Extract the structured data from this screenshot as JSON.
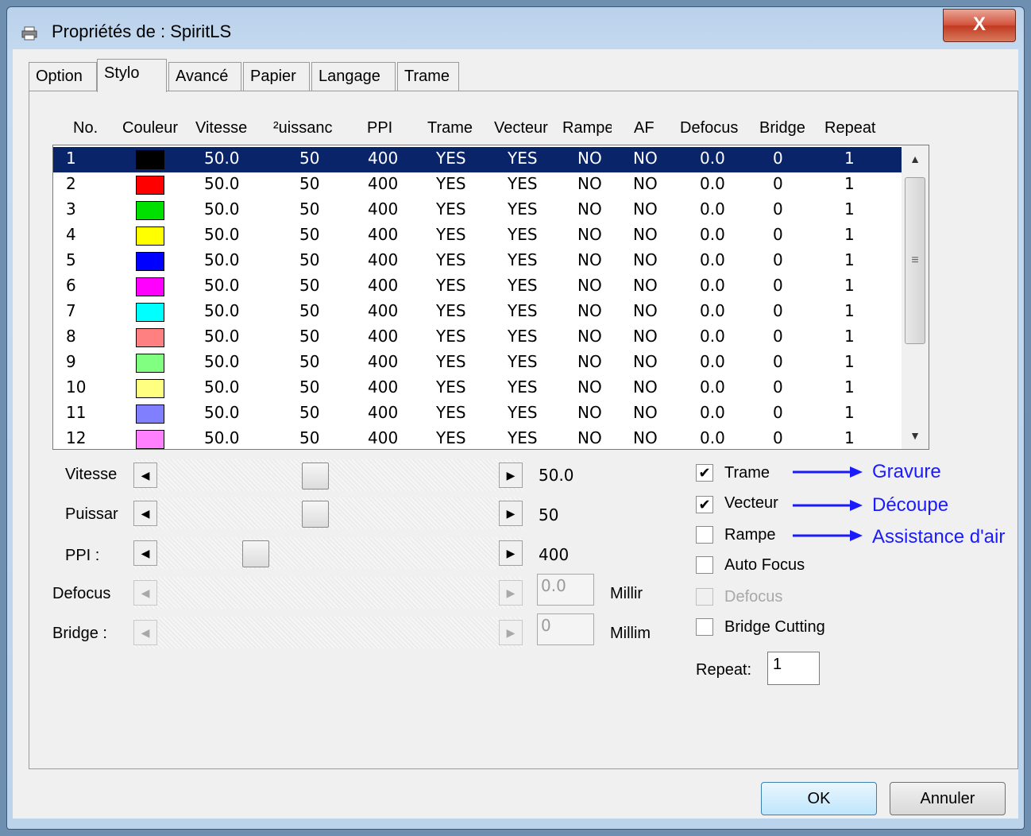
{
  "window": {
    "title": "Propriétés de : SpiritLS",
    "close_glyph": "X"
  },
  "tabs": [
    "Option",
    "Stylo",
    "Avancé",
    "Papier",
    "Langage",
    "Trame"
  ],
  "active_tab": "Stylo",
  "columns": [
    "No.",
    "Couleur",
    "Vitesse",
    "Puissance",
    "PPI",
    "Trame",
    "Vecteur",
    "Rampe",
    "AF",
    "Defocus",
    "Bridge",
    "Repeat"
  ],
  "column_display": [
    "No.",
    "Couleur",
    "Vitesse",
    "²uissanc",
    "PPI",
    "Trame",
    "Vecteur",
    "Rampe",
    "AF",
    "Defocus",
    "Bridge",
    "Repeat"
  ],
  "rows": [
    {
      "no": "1",
      "color": "#000000",
      "vitesse": "50.0",
      "puissance": "50",
      "ppi": "400",
      "trame": "YES",
      "vecteur": "YES",
      "rampe": "NO",
      "af": "NO",
      "defocus": "0.0",
      "bridge": "0",
      "repeat": "1"
    },
    {
      "no": "2",
      "color": "#ff0000",
      "vitesse": "50.0",
      "puissance": "50",
      "ppi": "400",
      "trame": "YES",
      "vecteur": "YES",
      "rampe": "NO",
      "af": "NO",
      "defocus": "0.0",
      "bridge": "0",
      "repeat": "1"
    },
    {
      "no": "3",
      "color": "#00e000",
      "vitesse": "50.0",
      "puissance": "50",
      "ppi": "400",
      "trame": "YES",
      "vecteur": "YES",
      "rampe": "NO",
      "af": "NO",
      "defocus": "0.0",
      "bridge": "0",
      "repeat": "1"
    },
    {
      "no": "4",
      "color": "#ffff00",
      "vitesse": "50.0",
      "puissance": "50",
      "ppi": "400",
      "trame": "YES",
      "vecteur": "YES",
      "rampe": "NO",
      "af": "NO",
      "defocus": "0.0",
      "bridge": "0",
      "repeat": "1"
    },
    {
      "no": "5",
      "color": "#0000ff",
      "vitesse": "50.0",
      "puissance": "50",
      "ppi": "400",
      "trame": "YES",
      "vecteur": "YES",
      "rampe": "NO",
      "af": "NO",
      "defocus": "0.0",
      "bridge": "0",
      "repeat": "1"
    },
    {
      "no": "6",
      "color": "#ff00ff",
      "vitesse": "50.0",
      "puissance": "50",
      "ppi": "400",
      "trame": "YES",
      "vecteur": "YES",
      "rampe": "NO",
      "af": "NO",
      "defocus": "0.0",
      "bridge": "0",
      "repeat": "1"
    },
    {
      "no": "7",
      "color": "#00ffff",
      "vitesse": "50.0",
      "puissance": "50",
      "ppi": "400",
      "trame": "YES",
      "vecteur": "YES",
      "rampe": "NO",
      "af": "NO",
      "defocus": "0.0",
      "bridge": "0",
      "repeat": "1"
    },
    {
      "no": "8",
      "color": "#ff8080",
      "vitesse": "50.0",
      "puissance": "50",
      "ppi": "400",
      "trame": "YES",
      "vecteur": "YES",
      "rampe": "NO",
      "af": "NO",
      "defocus": "0.0",
      "bridge": "0",
      "repeat": "1"
    },
    {
      "no": "9",
      "color": "#80ff80",
      "vitesse": "50.0",
      "puissance": "50",
      "ppi": "400",
      "trame": "YES",
      "vecteur": "YES",
      "rampe": "NO",
      "af": "NO",
      "defocus": "0.0",
      "bridge": "0",
      "repeat": "1"
    },
    {
      "no": "10",
      "color": "#ffff80",
      "vitesse": "50.0",
      "puissance": "50",
      "ppi": "400",
      "trame": "YES",
      "vecteur": "YES",
      "rampe": "NO",
      "af": "NO",
      "defocus": "0.0",
      "bridge": "0",
      "repeat": "1"
    },
    {
      "no": "11",
      "color": "#8080ff",
      "vitesse": "50.0",
      "puissance": "50",
      "ppi": "400",
      "trame": "YES",
      "vecteur": "YES",
      "rampe": "NO",
      "af": "NO",
      "defocus": "0.0",
      "bridge": "0",
      "repeat": "1"
    },
    {
      "no": "12",
      "color": "#ff80ff",
      "vitesse": "50.0",
      "puissance": "50",
      "ppi": "400",
      "trame": "YES",
      "vecteur": "YES",
      "rampe": "NO",
      "af": "NO",
      "defocus": "0.0",
      "bridge": "0",
      "repeat": "1"
    }
  ],
  "selected_row": "1",
  "sliders": {
    "vitesse": {
      "label": "Vitesse",
      "value": "50.0",
      "level": 0.46
    },
    "puissance": {
      "label": "Puissar",
      "value": "50",
      "level": 0.46
    },
    "ppi": {
      "label": "PPI :",
      "value": "400",
      "level": 0.27
    },
    "defocus": {
      "label": "Defocus",
      "value": "0.0",
      "unit": "Millir"
    },
    "bridge": {
      "label": "Bridge :",
      "value": "0",
      "unit": "Millim"
    }
  },
  "checkboxes": {
    "trame": {
      "label": "Trame",
      "checked": true,
      "annotation": "Gravure"
    },
    "vecteur": {
      "label": "Vecteur",
      "checked": true,
      "annotation": "Découpe"
    },
    "rampe": {
      "label": "Rampe",
      "checked": false,
      "annotation": "Assistance d'air"
    },
    "auto_focus": {
      "label": "Auto Focus",
      "checked": false
    },
    "defocus": {
      "label": "Defocus",
      "checked": false
    },
    "bridge_cutting": {
      "label": "Bridge Cutting",
      "checked": false
    }
  },
  "check_mark": "✔",
  "repeat": {
    "label": "Repeat:",
    "value": "1"
  },
  "buttons": {
    "ok": "OK",
    "cancel": "Annuler"
  },
  "colors": {
    "selection": "#0a246a",
    "annotation": "#1a1aff",
    "window_frame": "#b9d1ea"
  }
}
